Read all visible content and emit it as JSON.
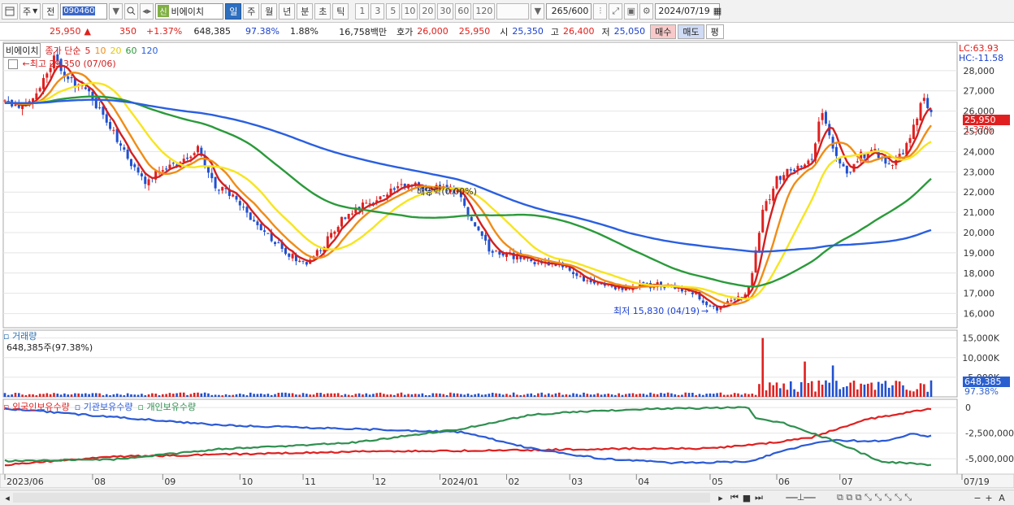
{
  "toolbar": {
    "period_select": "주",
    "prev_label": "전",
    "code": "090460",
    "name_badge": "신",
    "name": "비에이치",
    "period_tabs": [
      "일",
      "주",
      "월",
      "년",
      "분",
      "초",
      "틱"
    ],
    "active_period": "일",
    "interval_buttons": [
      "1",
      "3",
      "5",
      "10",
      "20",
      "30",
      "60",
      "120"
    ],
    "bar_count": "265",
    "bar_total": "/600",
    "date": "2024/07/19"
  },
  "quote": {
    "price": "25,950",
    "change_arrow": "▲",
    "change": "350",
    "change_pct": "+1.37%",
    "volume": "648,385",
    "volume_ratio": "97.38%",
    "turnover": "1.88%",
    "amount": "16,758백만",
    "ask_label": "호가",
    "ask": "26,000",
    "bid": "25,950",
    "open_label": "시",
    "open": "25,350",
    "high_label": "고",
    "high": "26,400",
    "low_label": "저",
    "low": "25,050",
    "buy_label": "매수",
    "sell_label": "매도",
    "pyeong_label": "평"
  },
  "price_legend": {
    "name": "비에이치",
    "ma_label": "종가 단순",
    "periods": [
      "5",
      "10",
      "20",
      "60",
      "120"
    ],
    "high_note": "최고 29,350 (07/06)",
    "low_note": "최저 15,830 (04/19)",
    "mid_note": "배당락(0.00%)"
  },
  "price_right": {
    "lc": "LC:63.93",
    "hc": "HC:-11.58",
    "last": "25,950",
    "last_pct": "1.37%"
  },
  "volume_legend": {
    "title": "거래량",
    "value": "648,385주(97.38%)",
    "last": "648,385",
    "last_pct": "97.38%"
  },
  "holdings_legend": [
    "외국인보유수량",
    "기관보유수량",
    "개인보유수량"
  ],
  "chart_data": {
    "type": "line",
    "price_axis": {
      "ticks": [
        "28,000",
        "27,000",
        "26,000",
        "25,000",
        "24,000",
        "23,000",
        "22,000",
        "21,000",
        "20,000",
        "19,000",
        "18,000",
        "17,000",
        "16,000"
      ],
      "ylim": [
        15300,
        29400
      ]
    },
    "volume_axis": {
      "ticks": [
        "15,000K",
        "10,000K",
        "5,000K"
      ],
      "ylim": [
        0,
        17000000
      ]
    },
    "holdings_axis": {
      "ticks": [
        "0",
        "-2,500,000",
        "-5,000,000"
      ],
      "ylim": [
        -6500000,
        800000
      ]
    },
    "x_labels": [
      "2023/06",
      "08",
      "09",
      "10",
      "11",
      "12",
      "2024/01",
      "02",
      "03",
      "04",
      "05",
      "06",
      "07",
      "07/19"
    ],
    "n_bars": 265,
    "close_anchors": [
      [
        0,
        26400
      ],
      [
        5,
        26300
      ],
      [
        10,
        27200
      ],
      [
        14,
        28700
      ],
      [
        18,
        27600
      ],
      [
        24,
        26800
      ],
      [
        28,
        25800
      ],
      [
        31,
        25000
      ],
      [
        35,
        23600
      ],
      [
        40,
        22600
      ],
      [
        45,
        23200
      ],
      [
        50,
        23400
      ],
      [
        55,
        24200
      ],
      [
        57,
        23300
      ],
      [
        60,
        22300
      ],
      [
        66,
        21700
      ],
      [
        72,
        20300
      ],
      [
        78,
        19400
      ],
      [
        82,
        18800
      ],
      [
        86,
        18500
      ],
      [
        90,
        19200
      ],
      [
        96,
        20600
      ],
      [
        102,
        21300
      ],
      [
        108,
        21800
      ],
      [
        114,
        22400
      ],
      [
        120,
        22200
      ],
      [
        126,
        22200
      ],
      [
        130,
        21800
      ],
      [
        134,
        20200
      ],
      [
        138,
        19200
      ],
      [
        143,
        18900
      ],
      [
        150,
        18600
      ],
      [
        158,
        18400
      ],
      [
        166,
        17600
      ],
      [
        174,
        17200
      ],
      [
        182,
        17400
      ],
      [
        188,
        17400
      ],
      [
        196,
        17100
      ],
      [
        202,
        16200
      ],
      [
        208,
        16600
      ],
      [
        212,
        17200
      ],
      [
        216,
        21000
      ],
      [
        220,
        22600
      ],
      [
        225,
        23200
      ],
      [
        230,
        23800
      ],
      [
        233,
        26000
      ],
      [
        236,
        24100
      ],
      [
        240,
        22800
      ],
      [
        244,
        23800
      ],
      [
        248,
        24000
      ],
      [
        252,
        23300
      ],
      [
        256,
        24000
      ],
      [
        259,
        25200
      ],
      [
        262,
        26700
      ],
      [
        264,
        25950
      ]
    ],
    "series": [
      {
        "name": "5",
        "color": "#d42020",
        "window": 5
      },
      {
        "name": "10",
        "color": "#f08c16",
        "window": 10
      },
      {
        "name": "20",
        "color": "#f7e51e",
        "window": 20
      },
      {
        "name": "60",
        "color": "#2a9a3a",
        "window": 60
      },
      {
        "name": "120",
        "color": "#2a5fe0",
        "window": 120
      }
    ],
    "holdings": [
      {
        "name": "외국인보유수량",
        "color": "#e02020",
        "anchors": [
          [
            0,
            -5600000
          ],
          [
            30,
            -4800000
          ],
          [
            60,
            -4600000
          ],
          [
            100,
            -4300000
          ],
          [
            140,
            -4200000
          ],
          [
            180,
            -4000000
          ],
          [
            200,
            -4000000
          ],
          [
            214,
            -3600000
          ],
          [
            220,
            -3400000
          ],
          [
            230,
            -2900000
          ],
          [
            245,
            -1200000
          ],
          [
            255,
            -600000
          ],
          [
            264,
            -100000
          ]
        ]
      },
      {
        "name": "기관보유수량",
        "color": "#2b5ad6",
        "anchors": [
          [
            0,
            -100000
          ],
          [
            30,
            -900000
          ],
          [
            60,
            -1700000
          ],
          [
            100,
            -2100000
          ],
          [
            130,
            -2400000
          ],
          [
            150,
            -4000000
          ],
          [
            170,
            -5000000
          ],
          [
            190,
            -5400000
          ],
          [
            212,
            -5300000
          ],
          [
            222,
            -4200000
          ],
          [
            235,
            -3200000
          ],
          [
            250,
            -3300000
          ],
          [
            258,
            -2600000
          ],
          [
            264,
            -2800000
          ]
        ]
      },
      {
        "name": "개인보유수량",
        "color": "#2f8f4f",
        "anchors": [
          [
            0,
            -5200000
          ],
          [
            30,
            -5100000
          ],
          [
            60,
            -4100000
          ],
          [
            100,
            -3400000
          ],
          [
            130,
            -2100000
          ],
          [
            150,
            -700000
          ],
          [
            170,
            -300000
          ],
          [
            190,
            -100000
          ],
          [
            212,
            0
          ],
          [
            214,
            -1100000
          ],
          [
            222,
            -1500000
          ],
          [
            235,
            -3100000
          ],
          [
            250,
            -5300000
          ],
          [
            264,
            -5600000
          ]
        ]
      }
    ],
    "volume_spikes": [
      [
        216,
        15000000
      ],
      [
        228,
        9000000
      ],
      [
        236,
        8000000
      ]
    ]
  }
}
